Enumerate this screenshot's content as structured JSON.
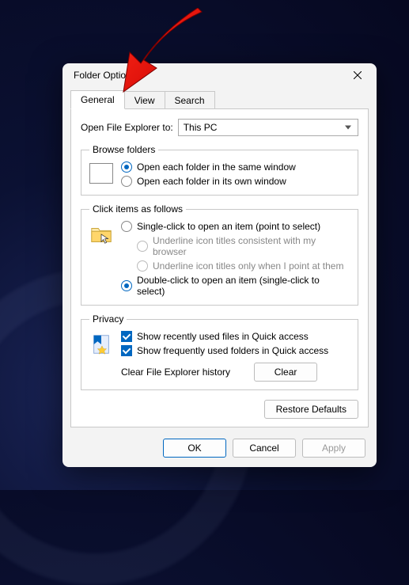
{
  "window": {
    "title": "Folder Options"
  },
  "tabs": {
    "general": "General",
    "view": "View",
    "search": "Search"
  },
  "open_explorer": {
    "label": "Open File Explorer to:",
    "value": "This PC"
  },
  "browse": {
    "legend": "Browse folders",
    "same_window": "Open each folder in the same window",
    "own_window": "Open each folder in its own window"
  },
  "click_items": {
    "legend": "Click items as follows",
    "single": "Single-click to open an item (point to select)",
    "underline_browser": "Underline icon titles consistent with my browser",
    "underline_point": "Underline icon titles only when I point at them",
    "double": "Double-click to open an item (single-click to select)"
  },
  "privacy": {
    "legend": "Privacy",
    "recent_files": "Show recently used files in Quick access",
    "freq_folders": "Show frequently used folders in Quick access",
    "clear_label": "Clear File Explorer history",
    "clear_btn": "Clear"
  },
  "restore_btn": "Restore Defaults",
  "footer": {
    "ok": "OK",
    "cancel": "Cancel",
    "apply": "Apply"
  }
}
